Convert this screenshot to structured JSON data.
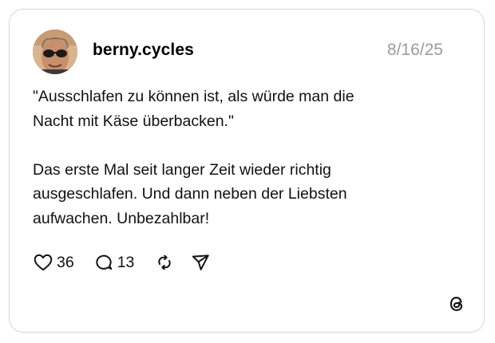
{
  "post": {
    "username": "berny.cycles",
    "date": "8/16/25",
    "paragraphs": [
      "\"Ausschlafen zu können ist, als würde man die\nNacht mit Käse überbacken.\"",
      "Das erste Mal seit langer Zeit wieder richtig\nausgeschlafen. Und dann neben der Liebsten\naufwachen. Unbezahlbar!"
    ]
  },
  "actions": {
    "likes": "36",
    "replies": "13",
    "icons": [
      "heart-icon",
      "comment-icon",
      "repost-icon",
      "share-icon"
    ]
  },
  "branding": {
    "icon": "threads-logo-icon"
  },
  "colors": {
    "border": "#d6d6d6",
    "date": "#9b9b9b",
    "text": "#111111",
    "background": "#ffffff"
  }
}
